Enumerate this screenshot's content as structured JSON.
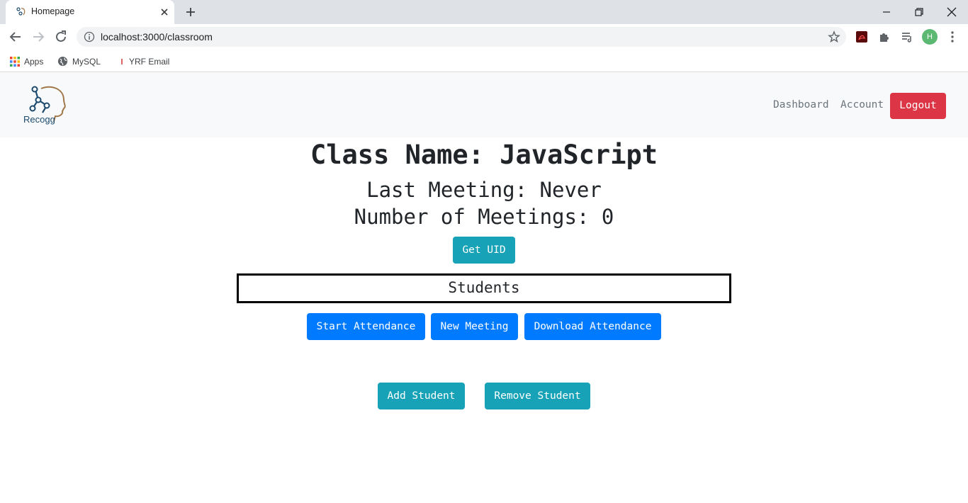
{
  "browser": {
    "tab_title": "Homepage",
    "url": "localhost:3000/classroom",
    "profile_initial": "H",
    "bookmarks": [
      {
        "label": "Apps"
      },
      {
        "label": "MySQL"
      },
      {
        "label": "YRF Email"
      }
    ]
  },
  "navbar": {
    "brand": "Recogg",
    "links": [
      {
        "label": "Dashboard"
      },
      {
        "label": "Account"
      }
    ],
    "logout_label": "Logout"
  },
  "classroom": {
    "title": "Class Name: JavaScript",
    "last_meeting": "Last Meeting: Never",
    "num_meetings": "Number of Meetings: 0",
    "get_uid_label": "Get UID",
    "students_heading": "Students",
    "actions": {
      "start_attendance": "Start Attendance",
      "new_meeting": "New Meeting",
      "download_attendance": "Download Attendance",
      "add_student": "Add Student",
      "remove_student": "Remove Student"
    }
  },
  "colors": {
    "danger": "#dc3545",
    "info": "#17a2b8",
    "primary": "#007bff"
  }
}
